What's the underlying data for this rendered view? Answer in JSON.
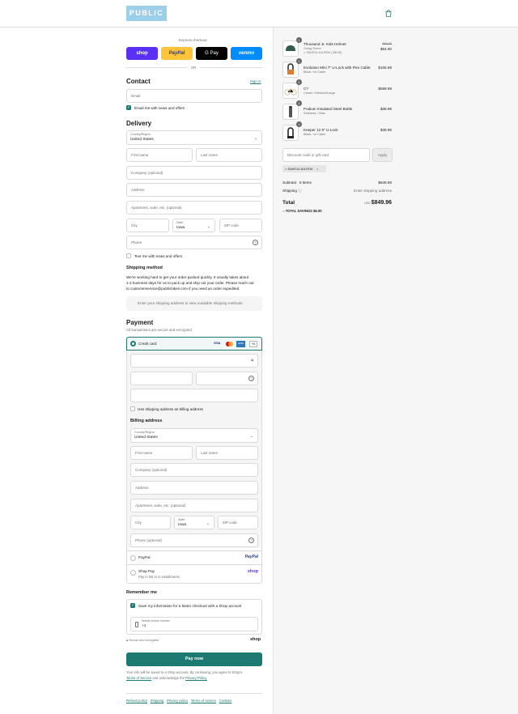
{
  "header": {
    "logo_text": "PUBLIC",
    "cart_icon": "shopping-bag-icon"
  },
  "express": {
    "title": "Express checkout",
    "buttons": [
      "shop",
      "PayPal",
      "G Pay",
      "venmo"
    ],
    "or": "OR"
  },
  "contact": {
    "title": "Contact",
    "sign_in": "Sign in",
    "email_placeholder": "Email",
    "news_checkbox": "Email me with news and offers",
    "news_checked": true
  },
  "delivery": {
    "title": "Delivery",
    "country_label": "Country/Region",
    "country_value": "United States",
    "first_name": "First name",
    "last_name": "Last name",
    "company": "Company (optional)",
    "address": "Address",
    "apartment": "Apartment, suite, etc. (optional)",
    "city": "City",
    "state_label": "State",
    "state_value": "Iowa",
    "zip": "ZIP code",
    "phone": "Phone",
    "text_checkbox": "Text me with news and offers"
  },
  "shipping_method": {
    "title": "Shipping method",
    "note_line1": "We're working hard to get your order packed quickly. It usually takes about",
    "note_line2": "1-2 business days for us to pack up and ship out your order. Please reach out",
    "note_line3": "to customerservice@publicbikes.com if you need an order expedited.",
    "placeholder_box": "Enter your shipping address to view available shipping methods."
  },
  "payment": {
    "title": "Payment",
    "subtitle": "All transactions are secure and encrypted.",
    "credit_card": "Credit card",
    "card_brands": [
      "VISA",
      "MC",
      "AMEX",
      "+4"
    ],
    "use_shipping": "Use shipping address as billing address",
    "billing_title": "Billing address",
    "paypal": "PayPal",
    "shoppay": "Shop Pay",
    "shoppay_sub": "Pay in full or in installments",
    "paypal_logo": "PayPal",
    "shop_logo": "shop"
  },
  "billing": {
    "country_label": "Country/Region",
    "country_value": "United States",
    "first_name": "First name",
    "last_name": "Last name",
    "company": "Company (optional)",
    "address": "Address",
    "apartment": "Apartment, suite, etc. (optional)",
    "city": "City",
    "state_label": "State",
    "state_value": "Iowa",
    "zip": "ZIP code",
    "phone": "Phone (optional)"
  },
  "remember": {
    "title": "Remember me",
    "save_info": "Save my information for a faster checkout with a Shop account",
    "mobile_label": "Mobile phone number",
    "mobile_value": "+1",
    "secure": "Secure and encrypted",
    "shop_logo": "shop"
  },
  "pay_now": "Pay now",
  "legal": {
    "line1": "Your info will be saved to a Shop account. By continuing, you agree to Shop's",
    "terms": "Terms of Service",
    "and": "and acknowledge the",
    "privacy": "Privacy Policy."
  },
  "footer_links": [
    "Refund policy",
    "Shipping",
    "Privacy policy",
    "Terms of service",
    "Cookies"
  ],
  "cart": {
    "items": [
      {
        "qty": "1",
        "name": "Thousand Jr. Kids Helmet",
        "variant": "Going Green",
        "discount": "SAVE10-8JLROK (-$6.00)",
        "compare": "$60.00",
        "price": "$54.00"
      },
      {
        "qty": "1",
        "name": "Evolution Mini 7\" U-Lock with Flex Cable",
        "variant": "Black / w/ Cable",
        "price": "$106.99"
      },
      {
        "qty": "1",
        "name": "C7",
        "variant": "Cream / Medium/Large",
        "price": "$599.99"
      },
      {
        "qty": "1",
        "name": "Podium Insulated Steel Bottle",
        "variant": "Stainless / 18oz",
        "price": "$38.99"
      },
      {
        "qty": "1",
        "name": "Keeper 12 9\" U-Lock",
        "variant": "Black / w/ Cable",
        "price": "$49.99"
      }
    ],
    "discount_placeholder": "Discount code or gift card",
    "apply": "Apply",
    "applied_code": "SAVE10-8JLROK",
    "subtotal_label": "Subtotal · 5 items",
    "subtotal": "$849.96",
    "shipping_label": "Shipping",
    "shipping_value": "Enter shipping address",
    "total_label": "Total",
    "currency": "USD",
    "total": "$849.96",
    "savings_label": "TOTAL SAVINGS",
    "savings": "$6.00"
  },
  "colors": {
    "accent": "#1d7a72",
    "shop": "#5a31f4",
    "paypal": "#ffc439",
    "venmo": "#008cff",
    "logo_bg": "#9cd0ea"
  }
}
